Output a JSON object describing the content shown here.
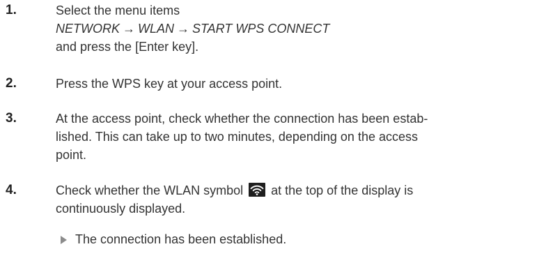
{
  "steps": [
    {
      "number": "1.",
      "lines": [
        "Select the menu items"
      ],
      "menu_path": [
        "NETWORK",
        "WLAN",
        "START WPS CONNECT"
      ],
      "arrow": "→",
      "tail": "and press the [Enter key]."
    },
    {
      "number": "2.",
      "lines": [
        "Press the WPS key at your access point."
      ]
    },
    {
      "number": "3.",
      "lines": [
        "At the access point, check whether the connection has been estab-",
        "lished. This can take up to two minutes, depending on the access",
        "point."
      ]
    },
    {
      "number": "4.",
      "line1_before_icon": "Check whether the WLAN symbol",
      "icon": "wlan-icon",
      "line1_after_icon": "at the top of the display is",
      "line2": "continuously displayed."
    }
  ],
  "result": {
    "marker": "triangle-right-icon",
    "text": "The connection has been established."
  },
  "colors": {
    "text": "#333333",
    "icon_bg": "#1f1f1f",
    "marker": "#8c8c8c"
  }
}
